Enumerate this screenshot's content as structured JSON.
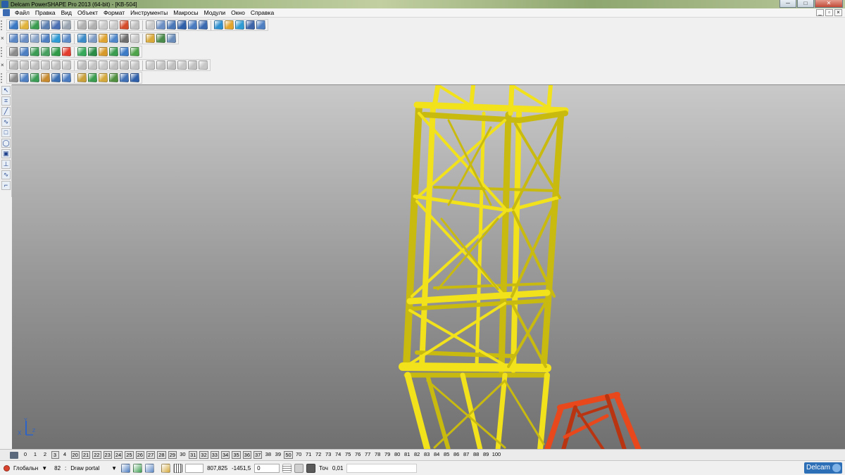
{
  "window": {
    "title": "Delcam PowerSHAPE Pro 2013 (64-bit) - [KB-504]",
    "controls": [
      "─",
      "□",
      "✕"
    ]
  },
  "menu": {
    "items": [
      "Файл",
      "Правка",
      "Вид",
      "Объект",
      "Формат",
      "Инструменты",
      "Макросы",
      "Модули",
      "Окно",
      "Справка"
    ],
    "mdi_controls": [
      "_",
      "▫",
      "×"
    ]
  },
  "toolbar_colors": {
    "row1": [
      "#3b78c4",
      "#e2b33a",
      "#3a9c4e",
      "#5b7fb0",
      "#4a6fb2",
      "#9aa5b1",
      "#b0b0b0",
      "#b0b0b0",
      "#c9c9c9",
      "#c9c9c9",
      "#d44c2a",
      "#c0c0c0",
      "#c9c9c9",
      "#6b8fc4",
      "#4876b7",
      "#2e5fa8",
      "#4a7bc0",
      "#3b6ab0",
      "#2c8fd0",
      "#e3a52b",
      "#2f9bd4",
      "#3d63a8",
      "#4d7fc2"
    ],
    "row2": [
      "#5b87c5",
      "#6b8fc4",
      "#8aa4c8",
      "#4d7fc2",
      "#2f9bd4",
      "#5f8dc8",
      "#3c8bc9",
      "#7d9bc2",
      "#e0a431",
      "#4e86c9",
      "#6d6d6d",
      "#c9c9c9",
      "#d9a93a",
      "#4a8a4a",
      "#6a8cb8"
    ],
    "row3": [
      "#8c8c8c",
      "#4d7fc2",
      "#3b9c55",
      "#46a060",
      "#2e9a48",
      "#e33b2c",
      "#36a85a",
      "#2a8c46",
      "#d79a2a",
      "#3a9c4e",
      "#3d7bc7",
      "#4fa34a"
    ],
    "row4": [
      "#b8b8b8",
      "#c2c2c2",
      "#bfbfbf",
      "#c5c5c5",
      "#c0c0c0",
      "#c6c6c6",
      "#bdbdbd",
      "#c3c3c3",
      "#c9c9c9",
      "#c1c1c1",
      "#bebebe",
      "#c4c4c4",
      "#c8c8c8",
      "#c2c2c2",
      "#bfbfbf",
      "#c6c6c6",
      "#c1c1c1",
      "#c7c7c7"
    ],
    "row5": [
      "#8c8c8c",
      "#4d7fc2",
      "#3b9c55",
      "#c78a2f",
      "#3a6fb3",
      "#4a7bc0",
      "#c9a03a",
      "#3a9c4e",
      "#d4a83b",
      "#4f8f3f",
      "#3f6fb5",
      "#2e5fa8"
    ]
  },
  "vertical_toolbar": {
    "tools": [
      "↖",
      "⌗",
      "╱",
      "∿",
      "□",
      "◯",
      "▣",
      "⊥",
      "∿",
      "⌐"
    ]
  },
  "viewport": {
    "colors": {
      "structure": "#f2e21b",
      "structure_shade": "#c9ba10",
      "portal": "#e8481c",
      "portal_shade": "#b93512"
    },
    "axes": {
      "x": "X",
      "y": "Y",
      "z": "Z"
    }
  },
  "level_bar": {
    "levels": [
      {
        "n": "0",
        "boxed": false
      },
      {
        "n": "1",
        "boxed": false
      },
      {
        "n": "2",
        "boxed": false
      },
      {
        "n": "3",
        "boxed": true
      },
      {
        "n": "4",
        "boxed": false
      },
      {
        "n": "20",
        "boxed": true
      },
      {
        "n": "21",
        "boxed": true
      },
      {
        "n": "22",
        "boxed": true
      },
      {
        "n": "23",
        "boxed": true
      },
      {
        "n": "24",
        "boxed": true
      },
      {
        "n": "25",
        "boxed": true
      },
      {
        "n": "26",
        "boxed": true
      },
      {
        "n": "27",
        "boxed": true
      },
      {
        "n": "28",
        "boxed": true
      },
      {
        "n": "29",
        "boxed": true
      },
      {
        "n": "30",
        "boxed": false
      },
      {
        "n": "31",
        "boxed": true
      },
      {
        "n": "32",
        "boxed": true
      },
      {
        "n": "33",
        "boxed": true
      },
      {
        "n": "34",
        "boxed": true
      },
      {
        "n": "35",
        "boxed": true
      },
      {
        "n": "36",
        "boxed": true
      },
      {
        "n": "37",
        "boxed": true
      },
      {
        "n": "38",
        "boxed": false
      },
      {
        "n": "39",
        "boxed": false
      },
      {
        "n": "50",
        "boxed": true
      },
      {
        "n": "70",
        "boxed": false
      },
      {
        "n": "71",
        "boxed": false
      },
      {
        "n": "72",
        "boxed": false
      },
      {
        "n": "73",
        "boxed": false
      },
      {
        "n": "74",
        "boxed": false
      },
      {
        "n": "75",
        "boxed": false
      },
      {
        "n": "76",
        "boxed": false
      },
      {
        "n": "77",
        "boxed": false
      },
      {
        "n": "78",
        "boxed": false
      },
      {
        "n": "79",
        "boxed": false
      },
      {
        "n": "80",
        "boxed": false
      },
      {
        "n": "81",
        "boxed": false
      },
      {
        "n": "82",
        "boxed": false
      },
      {
        "n": "83",
        "boxed": false
      },
      {
        "n": "84",
        "boxed": false
      },
      {
        "n": "85",
        "boxed": false
      },
      {
        "n": "86",
        "boxed": false
      },
      {
        "n": "87",
        "boxed": false
      },
      {
        "n": "88",
        "boxed": false
      },
      {
        "n": "89",
        "boxed": false
      },
      {
        "n": "100",
        "boxed": false
      }
    ]
  },
  "status": {
    "workplane": "Глобальн",
    "level_number": "82",
    "level_name": "Draw portal",
    "coord_x": "807,825",
    "coord_y": "-1451,5",
    "coord_z": "0",
    "snap_label": "Точ",
    "tolerance": "0,01",
    "icon_colors": [
      "#4a7bc0",
      "#3a9c4e",
      "#5b87c5",
      "#d4a83b"
    ]
  },
  "brand": {
    "label": "Delcam"
  }
}
